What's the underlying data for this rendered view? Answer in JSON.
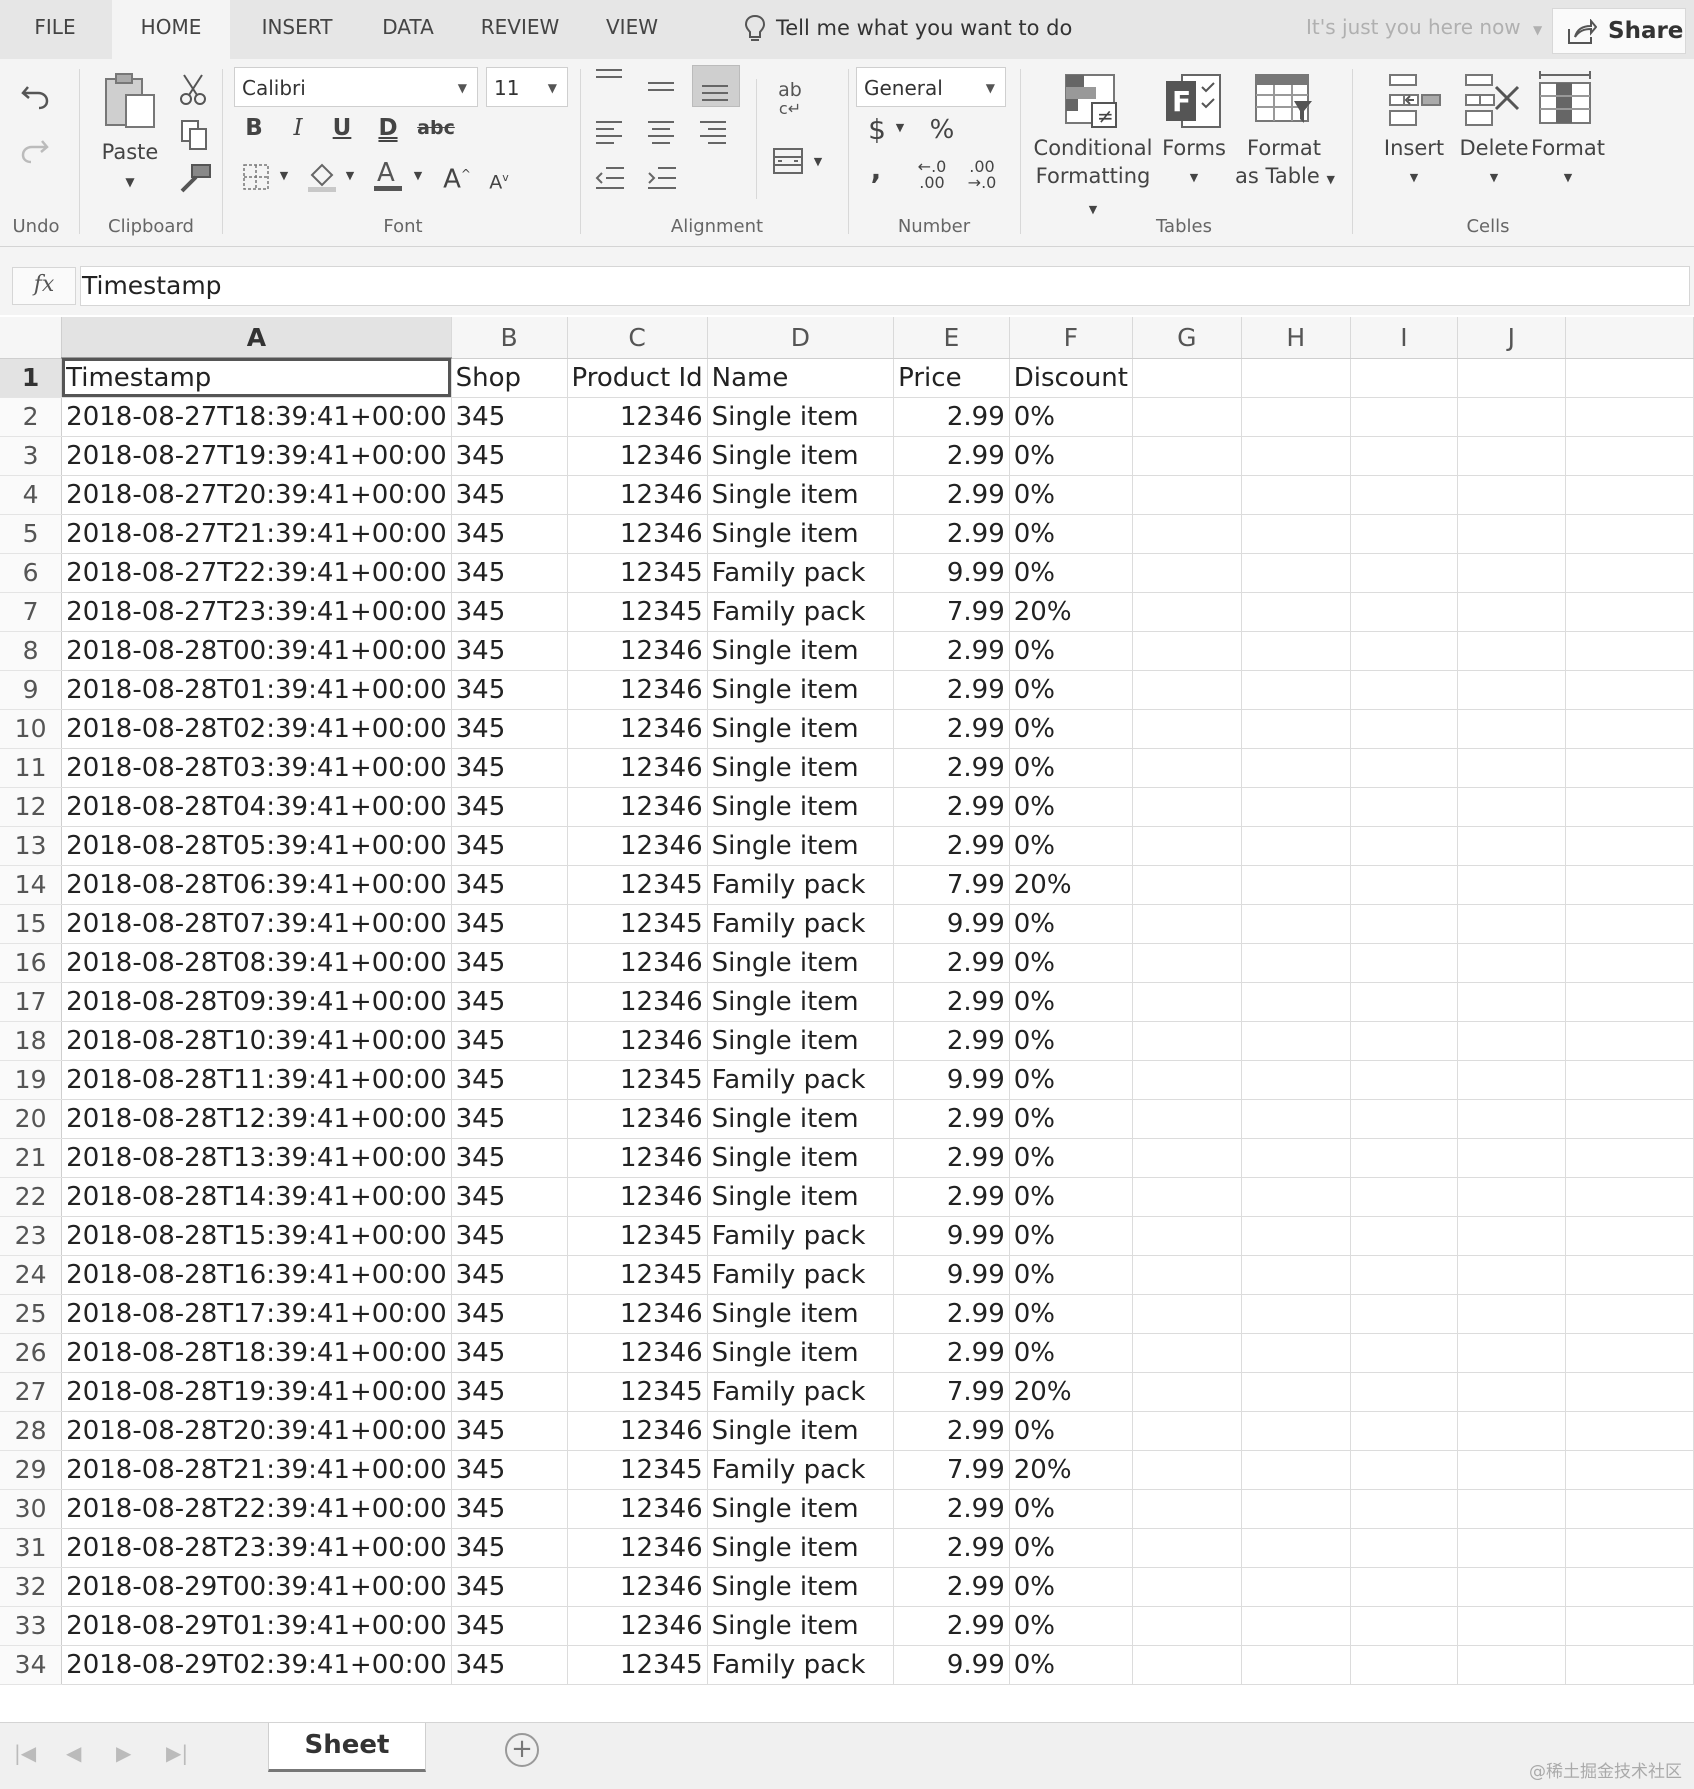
{
  "tabs": {
    "file": "FILE",
    "home": "HOME",
    "insert": "INSERT",
    "data": "DATA",
    "review": "REVIEW",
    "view": "VIEW"
  },
  "tell_me": "Tell me what you want to do",
  "presence": "It's just you here now",
  "share_label": "Share",
  "ribbon": {
    "undo_group": "Undo",
    "paste": "Paste",
    "clipboard_group": "Clipboard",
    "font_name": "Calibri",
    "font_size": "11",
    "font_group": "Font",
    "bold": "B",
    "italic": "I",
    "underline": "U",
    "double_underline": "D",
    "strikethrough": "abc",
    "alignment_group": "Alignment",
    "wrap": "ab",
    "number_format": "General",
    "currency": "$",
    "percent": "%",
    "comma": ",",
    "number_group": "Number",
    "conditional_1": "Conditional",
    "conditional_2": "Formatting",
    "forms": "Forms",
    "format_table_1": "Format",
    "format_table_2": "as Table",
    "tables_group": "Tables",
    "insert": "Insert",
    "delete": "Delete",
    "format": "Format",
    "cells_group": "Cells"
  },
  "formula_bar": {
    "fx": "fx",
    "value": "Timestamp"
  },
  "columns": [
    "A",
    "B",
    "C",
    "D",
    "E",
    "F",
    "G",
    "H",
    "I",
    "J"
  ],
  "rows": [
    [
      "1",
      "Timestamp",
      "Shop",
      "Product Id",
      "Name",
      "Price",
      "Discount"
    ],
    [
      "2",
      "2018-08-27T18:39:41+00:00",
      "345",
      "12346",
      "Single item",
      "2.99",
      "0%"
    ],
    [
      "3",
      "2018-08-27T19:39:41+00:00",
      "345",
      "12346",
      "Single item",
      "2.99",
      "0%"
    ],
    [
      "4",
      "2018-08-27T20:39:41+00:00",
      "345",
      "12346",
      "Single item",
      "2.99",
      "0%"
    ],
    [
      "5",
      "2018-08-27T21:39:41+00:00",
      "345",
      "12346",
      "Single item",
      "2.99",
      "0%"
    ],
    [
      "6",
      "2018-08-27T22:39:41+00:00",
      "345",
      "12345",
      "Family pack",
      "9.99",
      "0%"
    ],
    [
      "7",
      "2018-08-27T23:39:41+00:00",
      "345",
      "12345",
      "Family pack",
      "7.99",
      "20%"
    ],
    [
      "8",
      "2018-08-28T00:39:41+00:00",
      "345",
      "12346",
      "Single item",
      "2.99",
      "0%"
    ],
    [
      "9",
      "2018-08-28T01:39:41+00:00",
      "345",
      "12346",
      "Single item",
      "2.99",
      "0%"
    ],
    [
      "10",
      "2018-08-28T02:39:41+00:00",
      "345",
      "12346",
      "Single item",
      "2.99",
      "0%"
    ],
    [
      "11",
      "2018-08-28T03:39:41+00:00",
      "345",
      "12346",
      "Single item",
      "2.99",
      "0%"
    ],
    [
      "12",
      "2018-08-28T04:39:41+00:00",
      "345",
      "12346",
      "Single item",
      "2.99",
      "0%"
    ],
    [
      "13",
      "2018-08-28T05:39:41+00:00",
      "345",
      "12346",
      "Single item",
      "2.99",
      "0%"
    ],
    [
      "14",
      "2018-08-28T06:39:41+00:00",
      "345",
      "12345",
      "Family pack",
      "7.99",
      "20%"
    ],
    [
      "15",
      "2018-08-28T07:39:41+00:00",
      "345",
      "12345",
      "Family pack",
      "9.99",
      "0%"
    ],
    [
      "16",
      "2018-08-28T08:39:41+00:00",
      "345",
      "12346",
      "Single item",
      "2.99",
      "0%"
    ],
    [
      "17",
      "2018-08-28T09:39:41+00:00",
      "345",
      "12346",
      "Single item",
      "2.99",
      "0%"
    ],
    [
      "18",
      "2018-08-28T10:39:41+00:00",
      "345",
      "12346",
      "Single item",
      "2.99",
      "0%"
    ],
    [
      "19",
      "2018-08-28T11:39:41+00:00",
      "345",
      "12345",
      "Family pack",
      "9.99",
      "0%"
    ],
    [
      "20",
      "2018-08-28T12:39:41+00:00",
      "345",
      "12346",
      "Single item",
      "2.99",
      "0%"
    ],
    [
      "21",
      "2018-08-28T13:39:41+00:00",
      "345",
      "12346",
      "Single item",
      "2.99",
      "0%"
    ],
    [
      "22",
      "2018-08-28T14:39:41+00:00",
      "345",
      "12346",
      "Single item",
      "2.99",
      "0%"
    ],
    [
      "23",
      "2018-08-28T15:39:41+00:00",
      "345",
      "12345",
      "Family pack",
      "9.99",
      "0%"
    ],
    [
      "24",
      "2018-08-28T16:39:41+00:00",
      "345",
      "12345",
      "Family pack",
      "9.99",
      "0%"
    ],
    [
      "25",
      "2018-08-28T17:39:41+00:00",
      "345",
      "12346",
      "Single item",
      "2.99",
      "0%"
    ],
    [
      "26",
      "2018-08-28T18:39:41+00:00",
      "345",
      "12346",
      "Single item",
      "2.99",
      "0%"
    ],
    [
      "27",
      "2018-08-28T19:39:41+00:00",
      "345",
      "12345",
      "Family pack",
      "7.99",
      "20%"
    ],
    [
      "28",
      "2018-08-28T20:39:41+00:00",
      "345",
      "12346",
      "Single item",
      "2.99",
      "0%"
    ],
    [
      "29",
      "2018-08-28T21:39:41+00:00",
      "345",
      "12345",
      "Family pack",
      "7.99",
      "20%"
    ],
    [
      "30",
      "2018-08-28T22:39:41+00:00",
      "345",
      "12346",
      "Single item",
      "2.99",
      "0%"
    ],
    [
      "31",
      "2018-08-28T23:39:41+00:00",
      "345",
      "12346",
      "Single item",
      "2.99",
      "0%"
    ],
    [
      "32",
      "2018-08-29T00:39:41+00:00",
      "345",
      "12346",
      "Single item",
      "2.99",
      "0%"
    ],
    [
      "33",
      "2018-08-29T01:39:41+00:00",
      "345",
      "12346",
      "Single item",
      "2.99",
      "0%"
    ],
    [
      "34",
      "2018-08-29T02:39:41+00:00",
      "345",
      "12345",
      "Family pack",
      "9.99",
      "0%"
    ]
  ],
  "sheet_tab": "Sheet",
  "add_sheet": "+",
  "watermark": "@稀土掘金技术社区"
}
